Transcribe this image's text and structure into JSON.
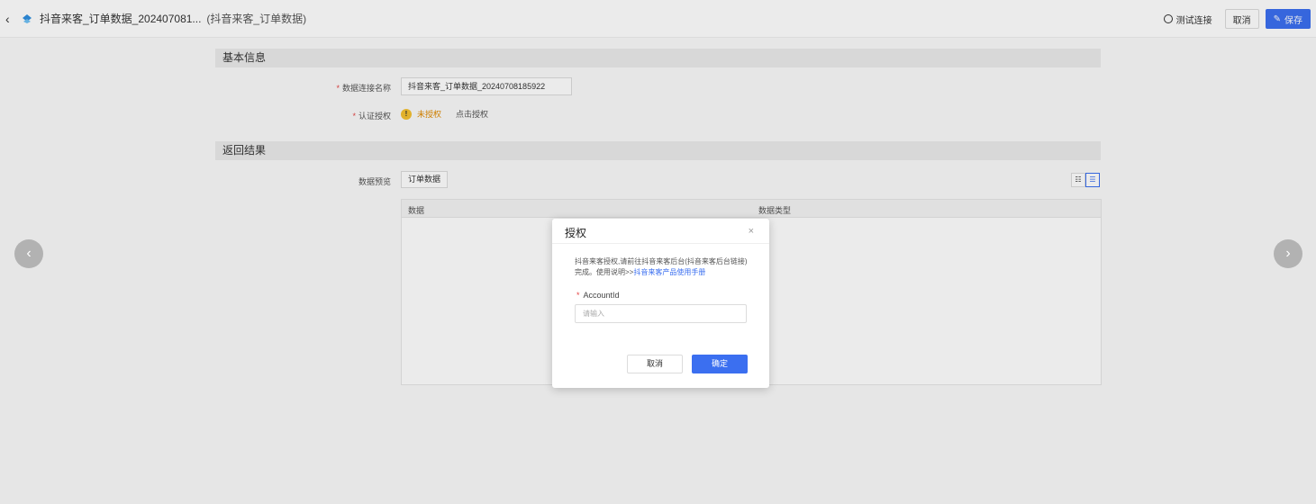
{
  "header": {
    "back_icon": "chevron-left-icon",
    "logo_icon": "datasource-logo-icon",
    "title": "抖音来客_订单数据_202407081...",
    "subtitle": "(抖音来客_订单数据)",
    "test_connection": "测试连接",
    "cancel": "取消",
    "save": "保存"
  },
  "basic_info": {
    "heading": "基本信息",
    "conn_name_label": "数据连接名称",
    "conn_name_value": "抖音来客_订单数据_20240708185922",
    "auth_label": "认证授权",
    "auth_status": "未授权",
    "auth_action": "点击授权"
  },
  "result": {
    "heading": "返回结果",
    "preview_label": "数据预览",
    "tab_label": "订单数据",
    "columns": [
      "数据",
      "数据类型"
    ]
  },
  "nav": {
    "prev": "‹",
    "next": "›"
  },
  "modal": {
    "title": "授权",
    "close": "×",
    "desc": "抖音来客授权,请前往抖音来客后台(抖音来客后台链接)完成。使用说明>>",
    "desc_link": "抖音来客产品使用手册",
    "field_label": "AccountId",
    "field_placeholder": "请输入",
    "cancel": "取消",
    "confirm": "确定"
  },
  "colors": {
    "primary": "#3b6ff0",
    "required": "#e54545",
    "warning": "#f5c030"
  }
}
